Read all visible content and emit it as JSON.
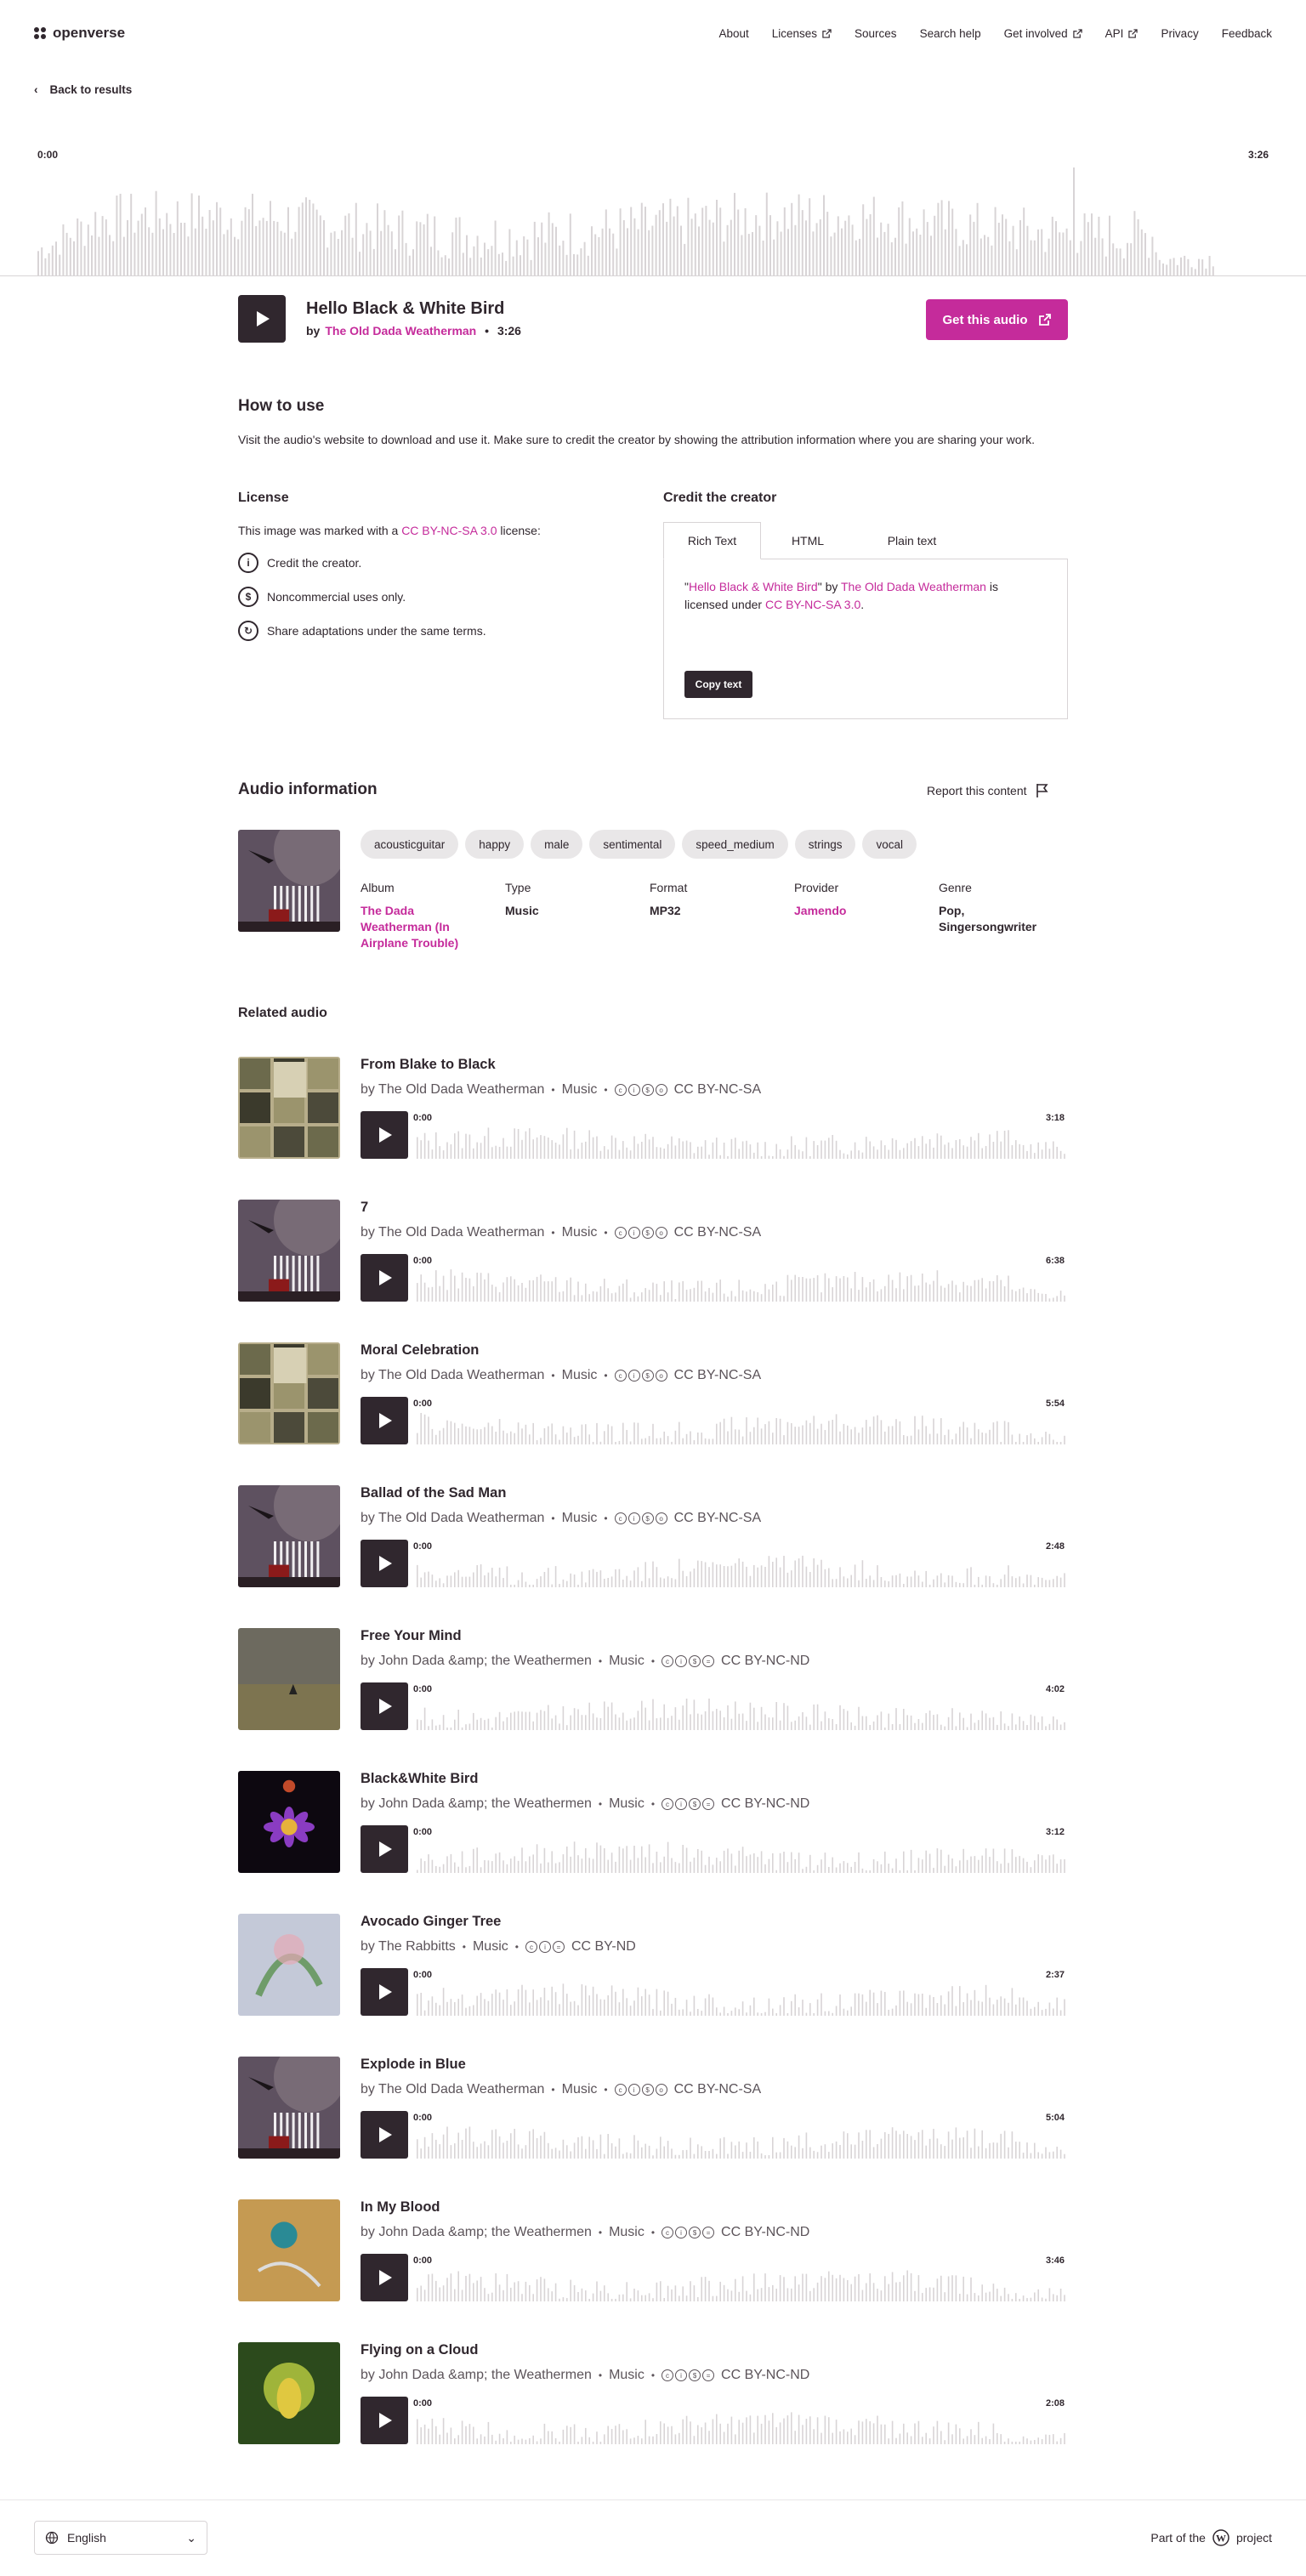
{
  "header": {
    "logo": "openverse",
    "nav": [
      {
        "label": "About",
        "ext": false
      },
      {
        "label": "Licenses",
        "ext": true
      },
      {
        "label": "Sources",
        "ext": false
      },
      {
        "label": "Search help",
        "ext": false
      },
      {
        "label": "Get involved",
        "ext": true
      },
      {
        "label": "API",
        "ext": true
      },
      {
        "label": "Privacy",
        "ext": false
      },
      {
        "label": "Feedback",
        "ext": false
      }
    ]
  },
  "back_label": "Back to results",
  "player": {
    "start": "0:00",
    "end": "3:26"
  },
  "audio": {
    "title": "Hello Black & White Bird",
    "by": "by",
    "creator": "The Old Dada Weatherman",
    "duration": "3:26",
    "get_label": "Get this audio"
  },
  "how_to_use": {
    "heading": "How to use",
    "text": "Visit the audio's website to download and use it. Make sure to credit the creator by showing the attribution information where you are sharing your work."
  },
  "license": {
    "heading": "License",
    "intro_pre": "This image was marked with a",
    "name": "CC BY-NC-SA 3.0",
    "intro_post": "license:",
    "terms": [
      "Credit the creator.",
      "Noncommercial uses only.",
      "Share adaptations under the same terms."
    ]
  },
  "credit": {
    "heading": "Credit the creator",
    "tabs": [
      "Rich Text",
      "HTML",
      "Plain text"
    ],
    "attr_title": "Hello Black & White Bird",
    "attr_by": "by",
    "attr_creator": "The Old Dada Weatherman",
    "attr_mid": "is licensed under",
    "attr_license": "CC BY-NC-SA 3.0",
    "copy_label": "Copy text"
  },
  "info": {
    "heading": "Audio information",
    "report": "Report this content",
    "tags": [
      "acousticguitar",
      "happy",
      "male",
      "sentimental",
      "speed_medium",
      "strings",
      "vocal"
    ],
    "meta": [
      {
        "k": "Album",
        "v": "The Dada Weatherman (In Airplane Trouble)",
        "link": true
      },
      {
        "k": "Type",
        "v": "Music",
        "link": false
      },
      {
        "k": "Format",
        "v": "MP32",
        "link": false
      },
      {
        "k": "Provider",
        "v": "Jamendo",
        "link": true
      },
      {
        "k": "Genre",
        "v": "Pop, Singersongwriter",
        "link": false
      }
    ]
  },
  "related": {
    "heading": "Related audio",
    "items": [
      {
        "title": "From Blake to Black",
        "creator": "by The Old Dada Weatherman",
        "type": "Music",
        "license": "CC BY-NC-SA",
        "start": "0:00",
        "end": "3:18",
        "art": "collage"
      },
      {
        "title": "7",
        "creator": "by The Old Dada Weatherman",
        "type": "Music",
        "license": "CC BY-NC-SA",
        "start": "0:00",
        "end": "6:38",
        "art": "plane"
      },
      {
        "title": "Moral Celebration",
        "creator": "by The Old Dada Weatherman",
        "type": "Music",
        "license": "CC BY-NC-SA",
        "start": "0:00",
        "end": "5:54",
        "art": "collage"
      },
      {
        "title": "Ballad of the Sad Man",
        "creator": "by The Old Dada Weatherman",
        "type": "Music",
        "license": "CC BY-NC-SA",
        "start": "0:00",
        "end": "2:48",
        "art": "plane"
      },
      {
        "title": "Free Your Mind",
        "creator": "by John Dada &amp; the Weathermen",
        "type": "Music",
        "license": "CC BY-NC-ND",
        "start": "0:00",
        "end": "4:02",
        "art": "field"
      },
      {
        "title": "Black&White Bird",
        "creator": "by John Dada &amp; the Weathermen",
        "type": "Music",
        "license": "CC BY-NC-ND",
        "start": "0:00",
        "end": "3:12",
        "art": "flower"
      },
      {
        "title": "Avocado Ginger Tree",
        "creator": "by The Rabbitts",
        "type": "Music",
        "license": "CC BY-ND",
        "start": "0:00",
        "end": "2:37",
        "art": "drawing"
      },
      {
        "title": "Explode in Blue",
        "creator": "by The Old Dada Weatherman",
        "type": "Music",
        "license": "CC BY-NC-SA",
        "start": "0:00",
        "end": "5:04",
        "art": "plane"
      },
      {
        "title": "In My Blood",
        "creator": "by John Dada &amp; the Weathermen",
        "type": "Music",
        "license": "CC BY-NC-ND",
        "start": "0:00",
        "end": "3:46",
        "art": "globe"
      },
      {
        "title": "Flying on a Cloud",
        "creator": "by John Dada &amp; the Weathermen",
        "type": "Music",
        "license": "CC BY-NC-ND",
        "start": "0:00",
        "end": "2:08",
        "art": "bird"
      }
    ]
  },
  "footer": {
    "language": "English",
    "part_of": "Part of the",
    "project": "project"
  },
  "colors": {
    "accent": "#c52b9b",
    "dark": "#30272e",
    "wave": "#d8d4d6"
  }
}
